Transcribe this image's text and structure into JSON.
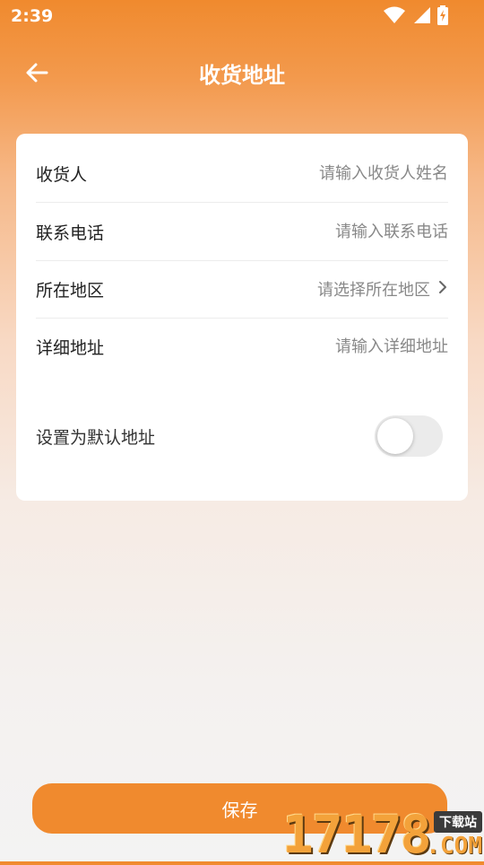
{
  "status_bar": {
    "time": "2:39",
    "icons": [
      "wifi-icon",
      "signal-icon",
      "battery-charging-icon"
    ]
  },
  "header": {
    "title": "收货地址",
    "back_icon": "back-arrow-icon"
  },
  "form": {
    "recipient": {
      "label": "收货人",
      "placeholder": "请输入收货人姓名",
      "value": ""
    },
    "phone": {
      "label": "联系电话",
      "placeholder": "请输入联系电话",
      "value": ""
    },
    "region": {
      "label": "所在地区",
      "placeholder": "请选择所在地区"
    },
    "detail": {
      "label": "详细地址",
      "placeholder": "请输入详细地址",
      "value": ""
    },
    "default_address": {
      "label": "设置为默认地址",
      "enabled": false
    }
  },
  "save_button": {
    "label": "保存"
  },
  "watermark": {
    "number": "17178",
    "badge": "下载站",
    "suffix": ".COM"
  },
  "colors": {
    "accent": "#f08a2e",
    "card": "#ffffff",
    "toggle_off": "#ebebeb"
  }
}
